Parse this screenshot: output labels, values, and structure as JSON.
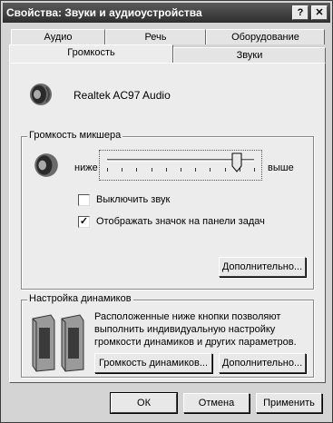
{
  "window": {
    "title": "Свойства: Звуки и аудиоустройства",
    "help_btn": "?",
    "close_btn": "✕"
  },
  "tabs": {
    "audio": "Аудио",
    "speech": "Речь",
    "hardware": "Оборудование",
    "volume": "Громкость",
    "sounds": "Звуки"
  },
  "device": {
    "name": "Realtek AC97 Audio",
    "icon": "speaker-icon"
  },
  "mixer": {
    "title": "Громкость микшера",
    "low_label": "ниже",
    "high_label": "выше",
    "level": 0.88,
    "mute_label": "Выключить звук",
    "mute_checked": false,
    "tray_label": "Отображать значок на панели задач",
    "tray_checked": true,
    "advanced_btn": "Дополнительно..."
  },
  "speakers": {
    "title": "Настройка динамиков",
    "desc_line1": "Расположенные ниже кнопки позволяют",
    "desc_line2": "выполнить индивидуальную настройку",
    "desc_line3": "громкости динамиков и других параметров.",
    "volume_btn": "Громкость динамиков...",
    "advanced_btn": "Дополнительно..."
  },
  "footer": {
    "ok": "ОК",
    "cancel": "Отмена",
    "apply": "Применить"
  }
}
